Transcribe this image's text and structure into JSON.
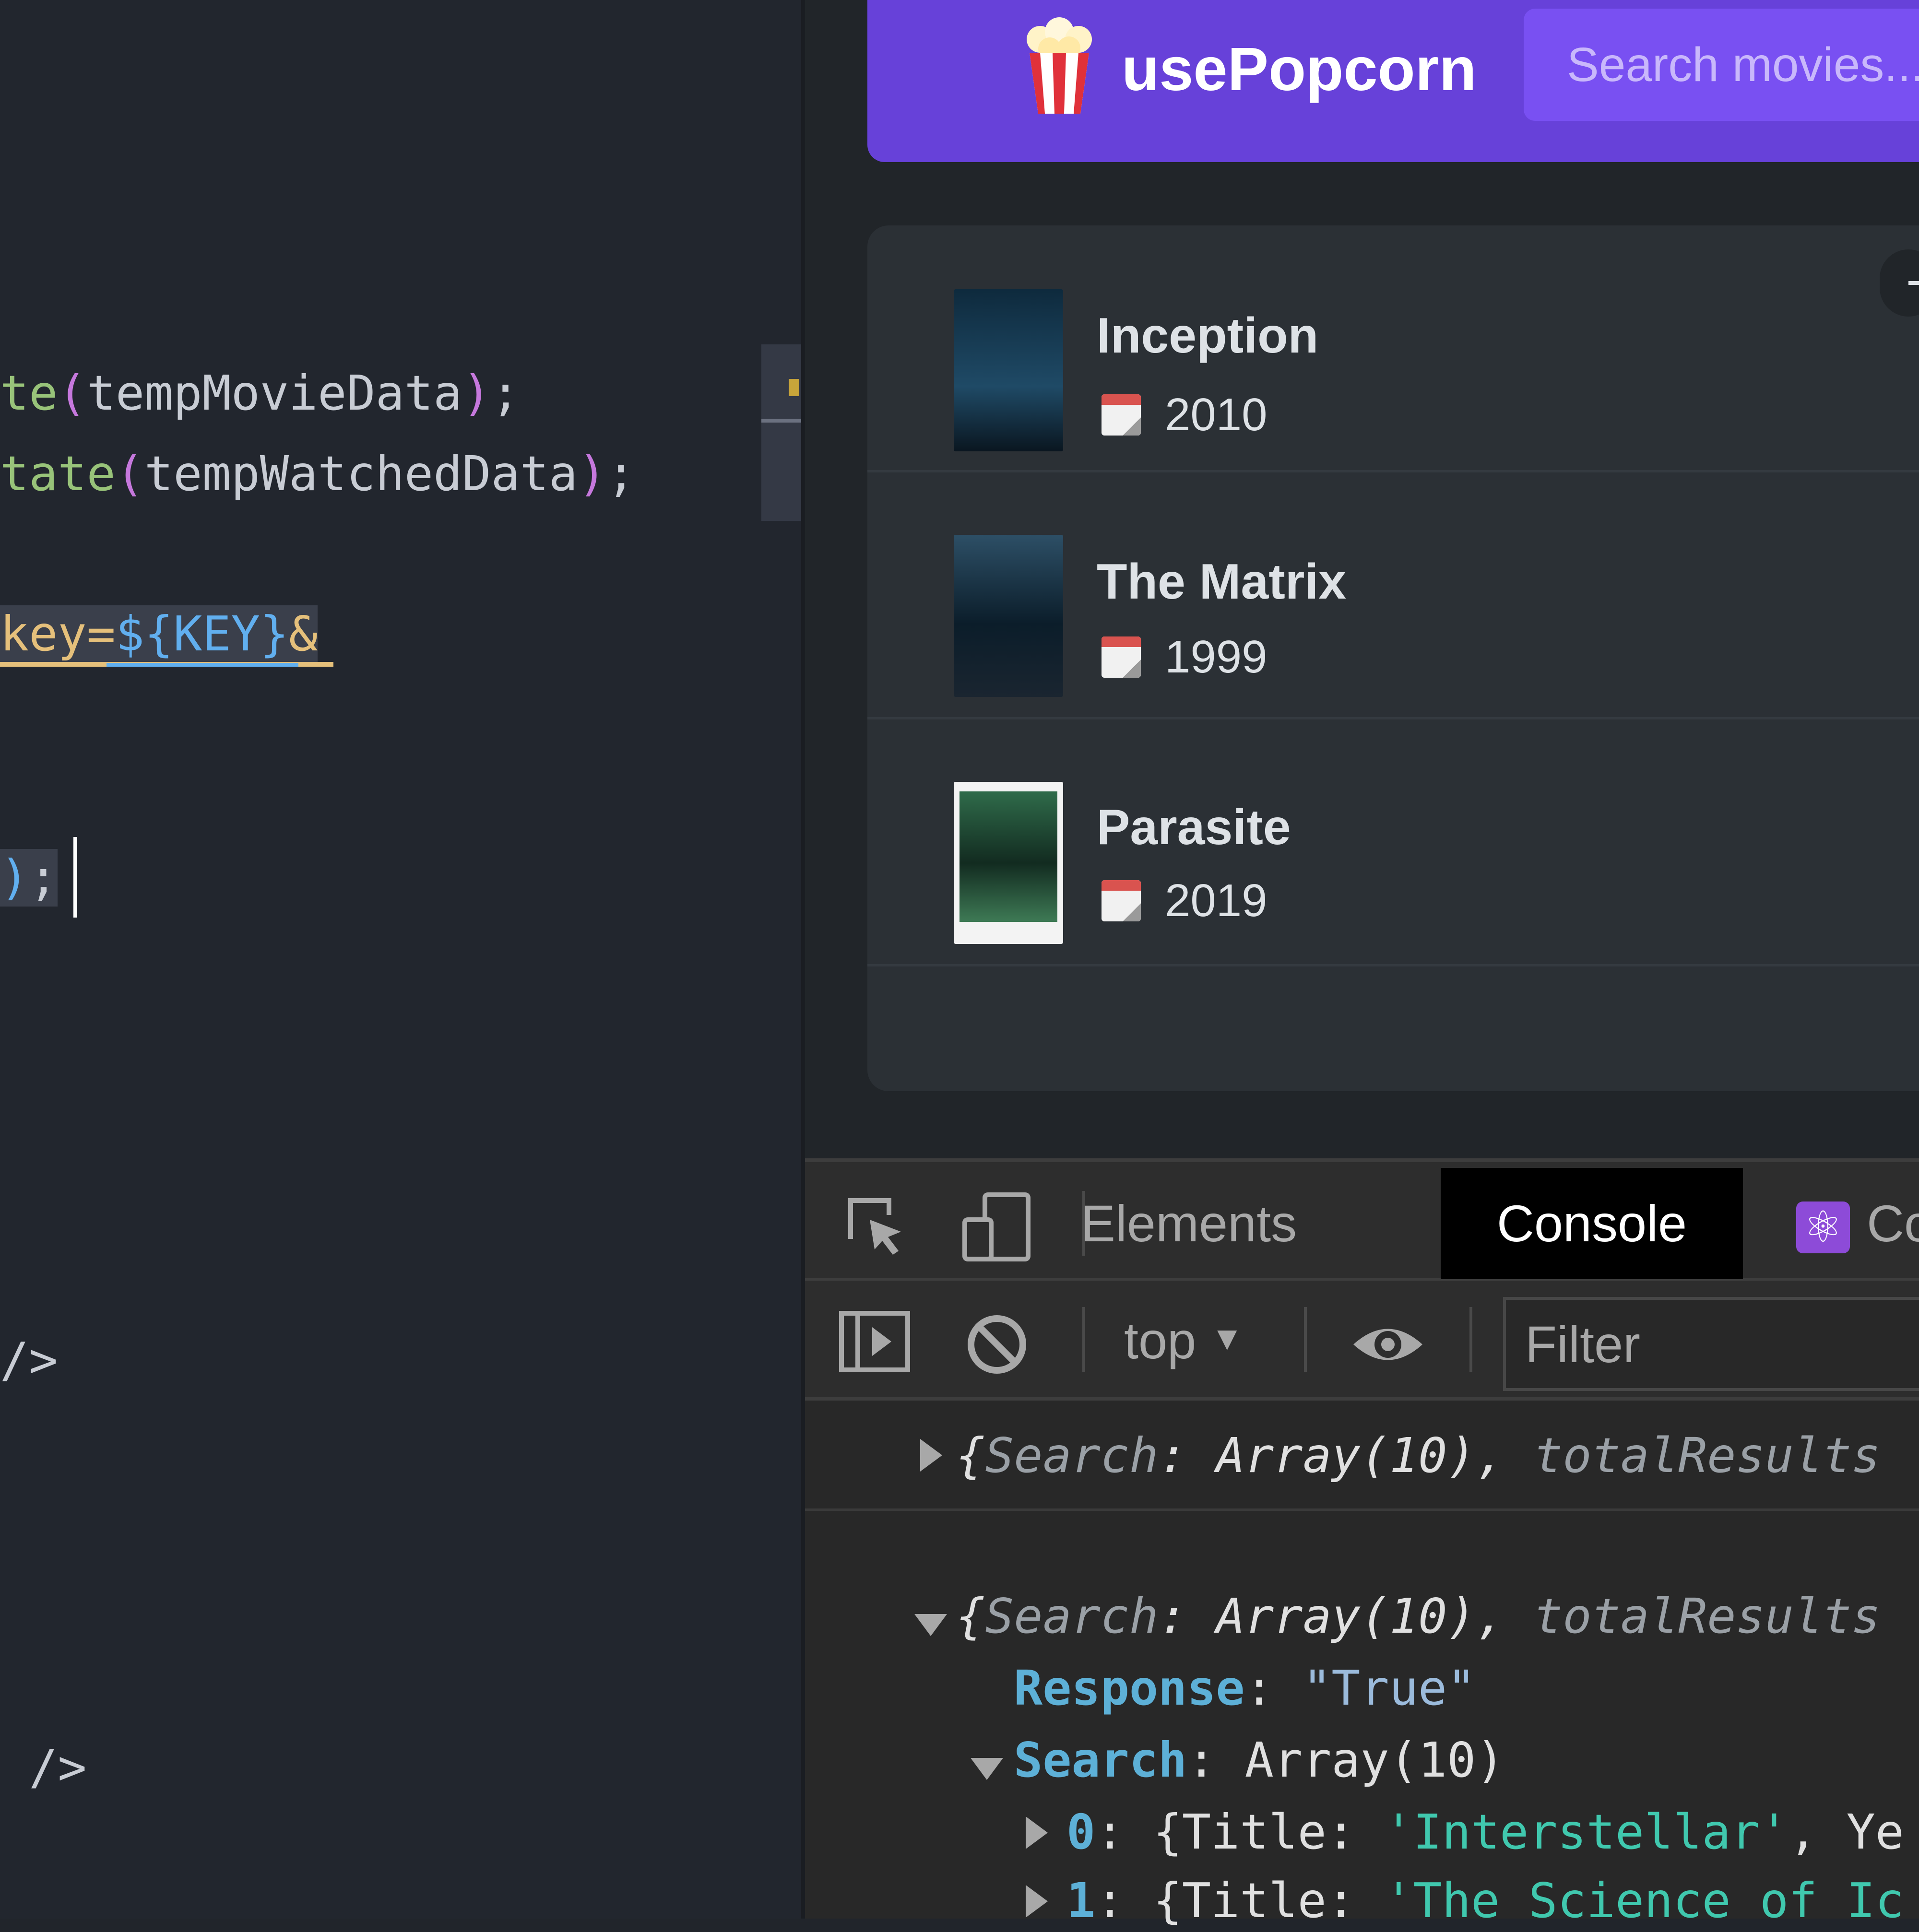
{
  "editor": {
    "line1": {
      "fn": "te",
      "open": "(",
      "arg": "tempMovieData",
      "close": ")",
      "end": ";"
    },
    "line2": {
      "fn": "tate",
      "open": "(",
      "arg": "tempWatchedData",
      "close": ")",
      "end": ";"
    },
    "line3": {
      "pre": "key=",
      "tpl": "${KEY}",
      "post": "&"
    },
    "line4": {
      "close": ")",
      "end": ";"
    },
    "line5": "/>",
    "line6": " />"
  },
  "app": {
    "logo_emoji": "🍿",
    "logo_text": "usePopcorn",
    "search_placeholder": "Search movies...",
    "toggle_label": "–",
    "movies": [
      {
        "title": "Inception",
        "year": "2010",
        "poster_colors": [
          "#0e2a3d",
          "#1f4a66"
        ]
      },
      {
        "title": "The Matrix",
        "year": "1999",
        "poster_colors": [
          "#0b1d2a",
          "#2d4f66"
        ]
      },
      {
        "title": "Parasite",
        "year": "2019",
        "poster_colors": [
          "#2f6b4a",
          "#122b20"
        ]
      }
    ]
  },
  "devtools": {
    "tabs": {
      "elements": "Elements",
      "console": "Console",
      "components": "Co"
    },
    "context": "top",
    "filter_placeholder": "Filter",
    "console": {
      "row1": {
        "open": "{",
        "key": "Search",
        "colon": ": ",
        "val": "Array(10)",
        "sep": ", ",
        "key2": "totalResults"
      },
      "row2": {
        "open": "{",
        "key": "Search",
        "colon": ": ",
        "val": "Array(10)",
        "sep": ", ",
        "key2": "totalResults"
      },
      "response_key": "Response",
      "response_val": "\"True\"",
      "search_key": "Search",
      "search_val": "Array(10)",
      "item0": {
        "idx": "0",
        "pre": "{Title: ",
        "title": "'Interstellar'",
        "post": ", Ye"
      },
      "item1": {
        "idx": "1",
        "pre": "{Title: ",
        "title": "'The Science of Ic"
      }
    }
  },
  "colors": {
    "navbar": "#6741d9",
    "search_bg": "#7950f2",
    "list_bg": "#2b3035",
    "app_bg": "#212529",
    "editor_bg": "#22262e"
  }
}
